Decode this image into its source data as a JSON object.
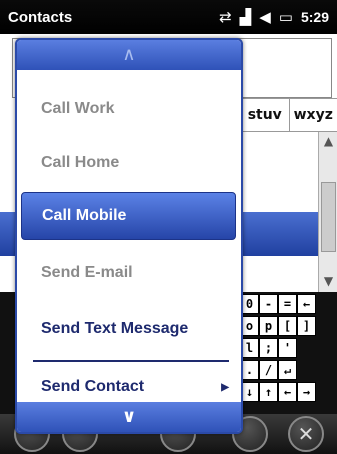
{
  "statusbar": {
    "title": "Contacts",
    "time": "5:29",
    "icons": [
      "connectivity-icon",
      "signal-icon",
      "volume-icon",
      "battery-icon"
    ]
  },
  "app": {
    "keypad_row": [
      "stuv",
      "wxyz"
    ]
  },
  "keyboard": {
    "rows": [
      [
        "0",
        "-",
        "=",
        "←"
      ],
      [
        "o",
        "p",
        "[",
        "]"
      ],
      [
        "l",
        ";",
        "'"
      ],
      [
        ".",
        "/",
        "↵"
      ],
      [
        "↓",
        "↑",
        "←",
        "→"
      ]
    ]
  },
  "menu": {
    "items": [
      {
        "label": "Call Work",
        "state": "disabled"
      },
      {
        "label": "Call Home",
        "state": "disabled"
      },
      {
        "label": "Call Mobile",
        "state": "highlight"
      },
      {
        "label": "Send E-mail",
        "state": "disabled"
      },
      {
        "label": "Send Text Message",
        "state": "enabled"
      },
      {
        "label": "Send Contact",
        "state": "enabled",
        "submenu": true
      }
    ],
    "up_arrow": "∧",
    "down_arrow": "∨"
  },
  "bottombar": {
    "close_glyph": "✕"
  },
  "colors": {
    "menu_border": "#2b4aa8",
    "highlight": "#2645a8",
    "enabled_text": "#1e2a6e",
    "disabled_text": "#8a8a8a"
  }
}
